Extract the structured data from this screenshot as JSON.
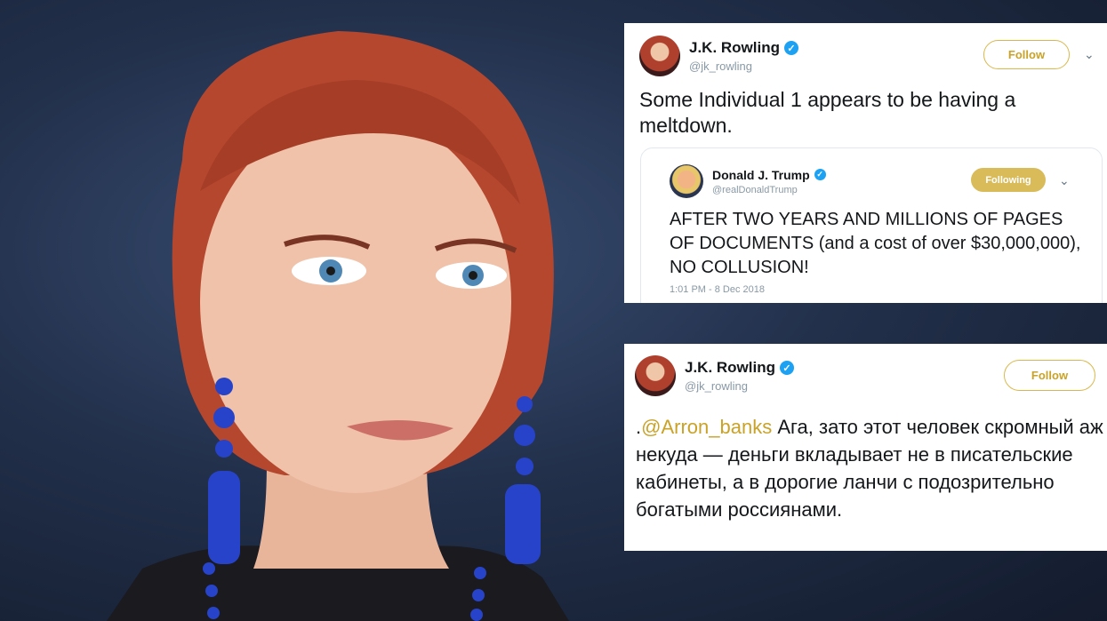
{
  "tweet1": {
    "author": "J.K. Rowling",
    "handle": "@jk_rowling",
    "follow_label": "Follow",
    "text": "Some Individual 1 appears to be having a meltdown.",
    "quoted": {
      "author": "Donald J. Trump",
      "handle": "@realDonaldTrump",
      "following_label": "Following",
      "text": "AFTER TWO YEARS AND MILLIONS OF PAGES OF DOCUMENTS (and a cost of over $30,000,000), NO COLLUSION!",
      "timestamp": "1:01 PM - 8 Dec 2018"
    }
  },
  "tweet2": {
    "author": "J.K. Rowling",
    "handle": "@jk_rowling",
    "follow_label": "Follow",
    "text_prefix": ".",
    "mention": "@Arron_banks",
    "text_body": " Ага, зато этот человек скромный аж некуда — деньги вкладывает не в писательские кабинеты, а в дорогие ланчи с подозрительно богатыми россиянами."
  },
  "colors": {
    "accent_gold": "#c9a227",
    "verified_blue": "#1da1f2",
    "background_navy": "#22304b",
    "earring_blue": "#2743c9"
  },
  "icons": [
    "verified-icon",
    "chevron-down-icon"
  ]
}
